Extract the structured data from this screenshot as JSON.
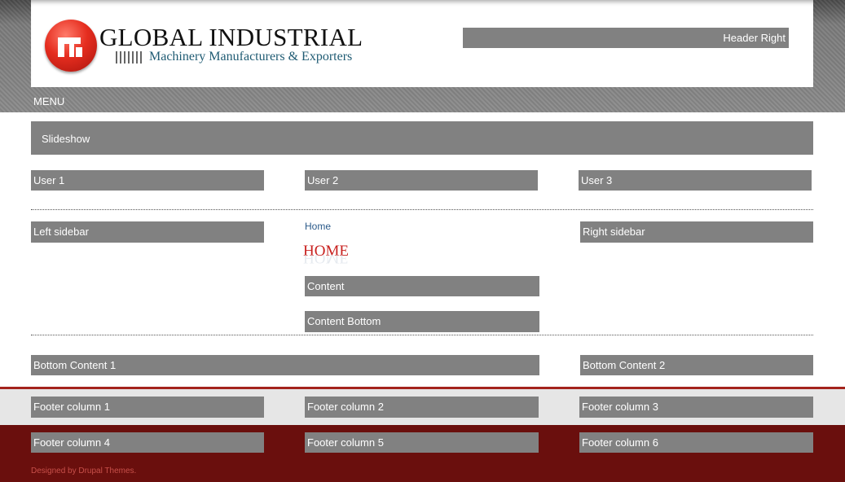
{
  "site": {
    "logo_title": "GLOBAL INDUSTRIAL",
    "logo_subtitle": "Machinery Manufacturers & Exporters",
    "brand_color": "#e52d1f",
    "subtitle_color": "#1f5b73"
  },
  "header": {
    "header_right": "Header Right"
  },
  "menu": {
    "label": "MENU"
  },
  "regions": {
    "slideshow": "Slideshow",
    "user_1": "User 1",
    "user_2": "User 2",
    "user_3": "User 3",
    "left_sidebar": "Left sidebar",
    "right_sidebar": "Right sidebar",
    "content": "Content",
    "content_bottom": "Content Bottom",
    "bottom_content_1": "Bottom Content 1",
    "bottom_content_2": "Bottom Content 2"
  },
  "main": {
    "breadcrumb": "Home",
    "page_title": "HOME"
  },
  "footer": {
    "columns": [
      "Footer column 1",
      "Footer column 2",
      "Footer column 3",
      "Footer column 4",
      "Footer column 5",
      "Footer column 6"
    ],
    "credits": "Designed by Drupal Themes."
  },
  "colors": {
    "region_grey": "#818181",
    "title_red": "#c8211f",
    "footer_dark": "#6a0f0d",
    "footer_line": "#a3231c",
    "footer_light": "#e6e6e6"
  }
}
